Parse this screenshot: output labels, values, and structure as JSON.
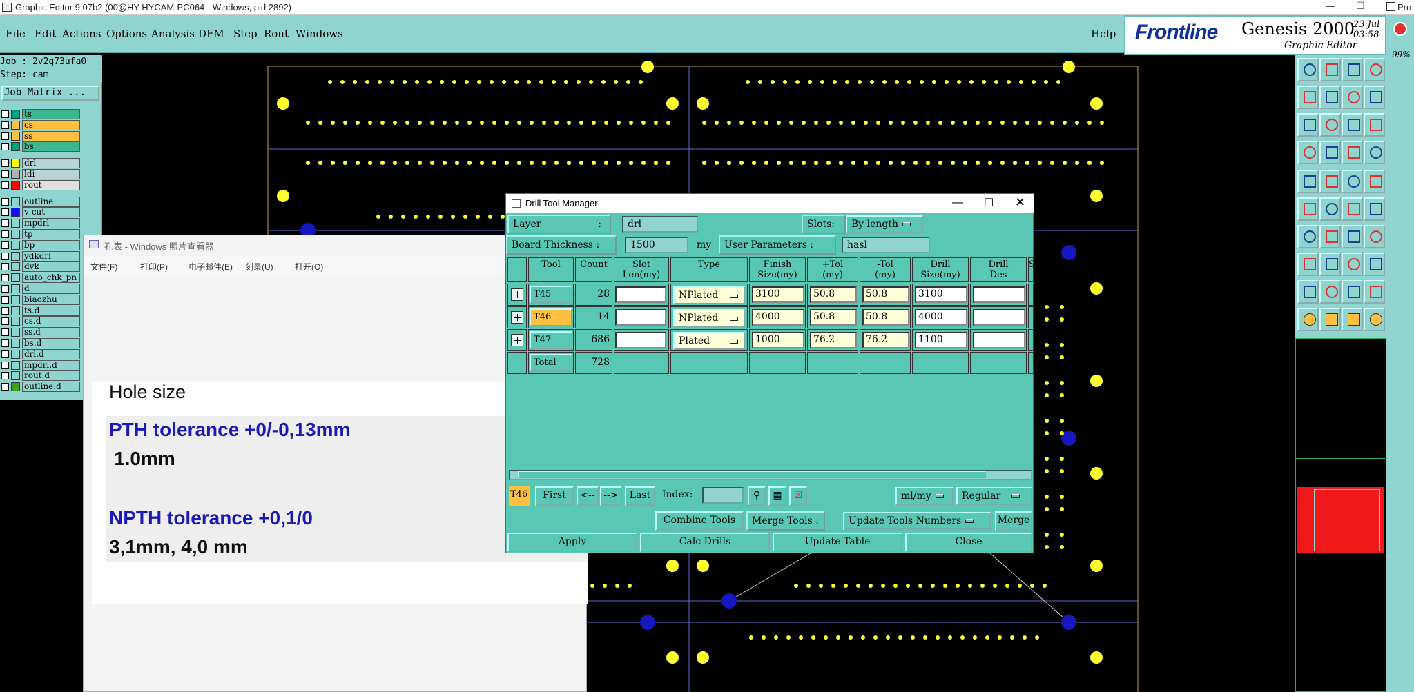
{
  "window": {
    "title": "Graphic Editor 9.07b2 (00@HY-HYCAM-PC064 - Windows, pid:2892)",
    "right_title": "Pro"
  },
  "menu": [
    "File",
    "Edit",
    "Actions",
    "Options",
    "Analysis",
    "DFM",
    "Step",
    "Rout",
    "Windows"
  ],
  "help": "Help",
  "brand": {
    "logo": "Frontline",
    "product": "Genesis 2000",
    "subtitle": "Graphic Editor",
    "date": "23 Jul",
    "time": "03:58",
    "zoom": "99%"
  },
  "job": {
    "job_line": "Job : 2v2g73ufa0",
    "step_line": "Step: cam",
    "matrix_button": "Job Matrix ..."
  },
  "layers": [
    {
      "name": "ts",
      "color": "#00a080",
      "bg": "#3cb890"
    },
    {
      "name": "cs",
      "color": "#ffbf40",
      "bg": "#ffbf40"
    },
    {
      "name": "ss",
      "color": "#ffbf40",
      "bg": "#ffbf40"
    },
    {
      "name": "bs",
      "color": "#00a080",
      "bg": "#3cb890"
    },
    {
      "name": "drl",
      "color": "#ffff00",
      "bg": "#b8d4d4"
    },
    {
      "name": "ldi",
      "color": "#b0b0b0",
      "bg": "#b8d4d4"
    },
    {
      "name": "rout",
      "color": "#ff0000",
      "bg": "#e0e0e0"
    },
    {
      "name": "outline",
      "color": "#8fd4cf",
      "bg": "#8fd4cf"
    },
    {
      "name": "v-cut",
      "color": "#1010ff",
      "bg": "#8fd4cf"
    },
    {
      "name": "mpdrl",
      "color": "#8fd4cf",
      "bg": "#8fd4cf"
    },
    {
      "name": "tp",
      "color": "#8fd4cf",
      "bg": "#8fd4cf"
    },
    {
      "name": "bp",
      "color": "#8fd4cf",
      "bg": "#8fd4cf"
    },
    {
      "name": "ydkdrl",
      "color": "#8fd4cf",
      "bg": "#8fd4cf"
    },
    {
      "name": "dvk",
      "color": "#8fd4cf",
      "bg": "#8fd4cf"
    },
    {
      "name": "auto_chk_pn",
      "color": "#8fd4cf",
      "bg": "#8fd4cf"
    },
    {
      "name": "d",
      "color": "#8fd4cf",
      "bg": "#8fd4cf"
    },
    {
      "name": "biaozhu",
      "color": "#8fd4cf",
      "bg": "#8fd4cf"
    },
    {
      "name": "ts.d",
      "color": "#8fd4cf",
      "bg": "#8fd4cf"
    },
    {
      "name": "cs.d",
      "color": "#8fd4cf",
      "bg": "#8fd4cf"
    },
    {
      "name": "ss.d",
      "color": "#8fd4cf",
      "bg": "#8fd4cf"
    },
    {
      "name": "bs.d",
      "color": "#8fd4cf",
      "bg": "#8fd4cf"
    },
    {
      "name": "drl.d",
      "color": "#8fd4cf",
      "bg": "#8fd4cf"
    },
    {
      "name": "mpdrl.d",
      "color": "#8fd4cf",
      "bg": "#8fd4cf"
    },
    {
      "name": "rout.d",
      "color": "#8fd4cf",
      "bg": "#8fd4cf"
    },
    {
      "name": "outline.d",
      "color": "#40a020",
      "bg": "#8fd4cf"
    }
  ],
  "photo_viewer": {
    "title": "孔表 - Windows 照片查看器",
    "menu": [
      "文件(F)",
      "打印(P)",
      "电子邮件(E)",
      "刻录(U)",
      "打开(O)"
    ],
    "heading": "Hole size",
    "pth_title": "PTH tolerance +0/-0,13mm",
    "pth_value": "1.0mm",
    "npth_title": "NPTH tolerance +0,1/0",
    "npth_value": "3,1mm, 4,0 mm"
  },
  "dialog": {
    "title": "Drill Tool Manager",
    "layer_label": "Layer",
    "layer_colon": ":",
    "layer_value": "drl",
    "slots_label": "Slots:",
    "slots_value": "By length",
    "thickness_label": "Board Thickness :",
    "thickness_value": "1500",
    "thickness_unit": "my",
    "user_params_label": "User Parameters :",
    "user_params_value": "hasl",
    "columns": [
      "Tool",
      "Count",
      "Slot\nLen(my)",
      "Type",
      "Finish\nSize(my)",
      "+Tol\n(my)",
      "-Tol\n(my)",
      "Drill\nSize(my)",
      "Drill\nDes",
      "S"
    ],
    "rows": [
      {
        "tool": "T45",
        "count": "28",
        "slot_len": "",
        "type": "NPlated",
        "finish": "3100",
        "ptol": "50.8",
        "mtol": "50.8",
        "drill": "3100",
        "des": "",
        "selected": false
      },
      {
        "tool": "T46",
        "count": "14",
        "slot_len": "",
        "type": "NPlated",
        "finish": "4000",
        "ptol": "50.8",
        "mtol": "50.8",
        "drill": "4000",
        "des": "",
        "selected": true
      },
      {
        "tool": "T47",
        "count": "686",
        "slot_len": "",
        "type": "Plated",
        "finish": "1000",
        "ptol": "76.2",
        "mtol": "76.2",
        "drill": "1100",
        "des": "",
        "selected": false
      }
    ],
    "total_label": "Total",
    "total_count": "728",
    "current_tool": "T46",
    "nav": {
      "first": "First",
      "prev": "<--",
      "next": "-->",
      "last": "Last",
      "index_label": "Index:"
    },
    "units": "ml/my",
    "mode": "Regular",
    "combine": "Combine Tools",
    "merge_label": "Merge Tools :",
    "update_numbers": "Update Tools Numbers",
    "merge": "Merge",
    "apply": "Apply",
    "calc": "Calc Drills",
    "update_table": "Update Table",
    "close": "Close"
  }
}
